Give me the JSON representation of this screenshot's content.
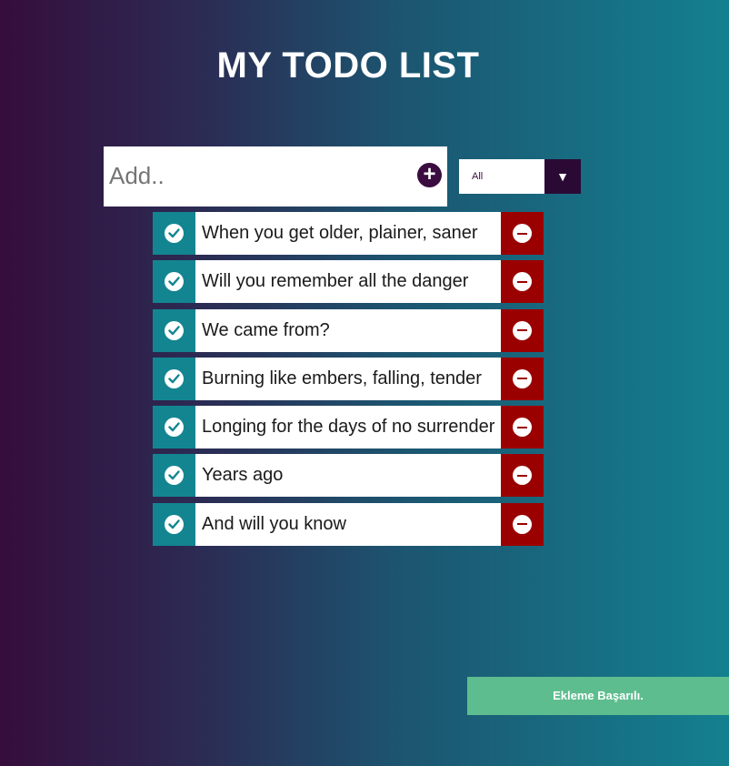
{
  "title": "MY TODO LIST",
  "add_form": {
    "placeholder": "Add..",
    "value": "",
    "add_icon": "plus-circle-icon"
  },
  "filter": {
    "selected": "All",
    "arrow_icon": "caret-down-icon"
  },
  "todos": [
    {
      "text": "When you get older, plainer, saner"
    },
    {
      "text": "Will you remember all the danger"
    },
    {
      "text": "We came from?"
    },
    {
      "text": "Burning like embers, falling, tender"
    },
    {
      "text": "Longing for the days of no surrender"
    },
    {
      "text": "Years ago"
    },
    {
      "text": "And will you know"
    }
  ],
  "toast": {
    "message": "Ekleme Başarılı."
  },
  "colors": {
    "check": "#138591",
    "delete": "#9b0000",
    "accent": "#3a0c40",
    "toast": "#5dbd8e"
  }
}
